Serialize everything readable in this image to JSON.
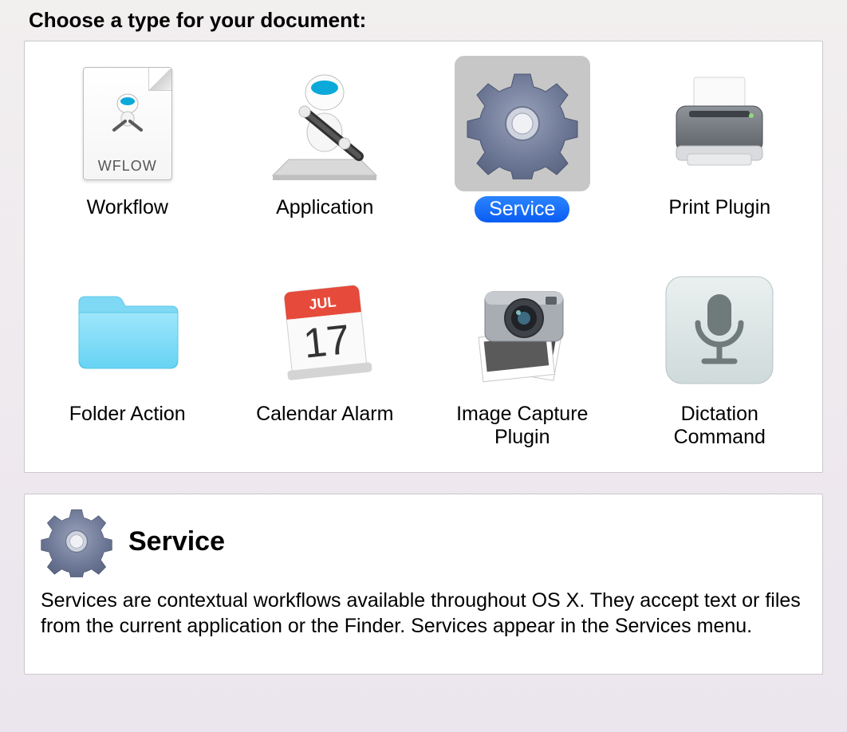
{
  "heading": "Choose a type for your document:",
  "types": [
    {
      "id": "workflow",
      "label": "Workflow",
      "wflow_text": "WFLOW",
      "icon": "workflow-icon",
      "selected": false
    },
    {
      "id": "application",
      "label": "Application",
      "icon": "application-icon",
      "selected": false
    },
    {
      "id": "service",
      "label": "Service",
      "icon": "service-icon",
      "selected": true
    },
    {
      "id": "print-plugin",
      "label": "Print Plugin",
      "icon": "printer-icon",
      "selected": false
    },
    {
      "id": "folder-action",
      "label": "Folder Action",
      "icon": "folder-icon",
      "selected": false
    },
    {
      "id": "calendar-alarm",
      "label": "Calendar Alarm",
      "icon": "calendar-icon",
      "cal_month": "JUL",
      "cal_day": "17",
      "selected": false
    },
    {
      "id": "image-capture",
      "label": "Image Capture Plugin",
      "icon": "image-capture-icon",
      "selected": false
    },
    {
      "id": "dictation",
      "label": "Dictation Command",
      "icon": "dictation-icon",
      "selected": false
    }
  ],
  "description": {
    "title": "Service",
    "body": "Services are contextual workflows available throughout OS X. They accept text or files from the current application or the Finder. Services appear in the Services menu."
  }
}
